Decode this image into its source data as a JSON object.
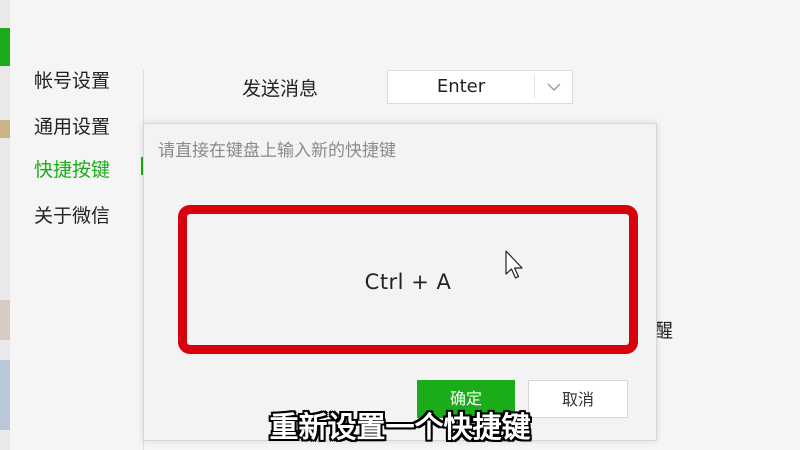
{
  "sidebar": {
    "items": [
      {
        "label": "帐号设置"
      },
      {
        "label": "通用设置"
      },
      {
        "label": "快捷按键",
        "active": true
      },
      {
        "label": "关于微信"
      }
    ]
  },
  "shortcut_row": {
    "label": "发送消息",
    "value": "Enter"
  },
  "partial_text": "醒",
  "dialog": {
    "hint": "请直接在键盘上输入新的快捷键",
    "key_combo": "Ctrl + A",
    "confirm_label": "确定",
    "cancel_label": "取消"
  },
  "caption": "重新设置一个快捷键",
  "colors": {
    "accent": "#1aad19",
    "highlight_border": "#d9000d"
  },
  "icons": {
    "dropdown": "chevron-down-icon",
    "pointer": "mouse-cursor-icon"
  }
}
